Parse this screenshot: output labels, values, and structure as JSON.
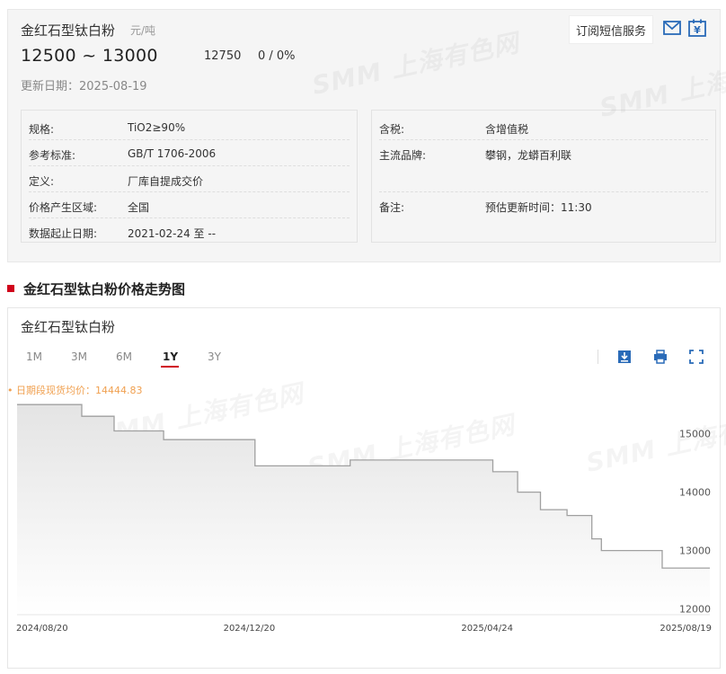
{
  "header": {
    "product_name": "金红石型钛白粉",
    "unit": "元/吨",
    "price_range": "12500 ~ 13000",
    "avg_price": "12750",
    "change": "0 / 0%",
    "update_date": "更新日期：2025-08-19",
    "subscribe_label": "订阅短信服务",
    "mail_icon": "mail-icon",
    "calendar_icon": "yuan-calendar-icon"
  },
  "specs_left": [
    {
      "label": "规格:",
      "value": "TiO2≥90%"
    },
    {
      "label": "参考标准:",
      "value": "GB/T 1706-2006"
    },
    {
      "label": "定义:",
      "value": "厂库自提成交价"
    },
    {
      "label": "价格产生区域:",
      "value": "全国"
    },
    {
      "label": "数据起止日期:",
      "value": "2021-02-24 至 --"
    }
  ],
  "specs_right": [
    {
      "label": "含税:",
      "value": "含增值税"
    },
    {
      "label": "主流品牌:",
      "value": "攀钢，龙蟒百利联"
    },
    {
      "label": "备注:",
      "value": "预估更新时间：11:30"
    }
  ],
  "section_title": "金红石型钛白粉价格走势图",
  "chart_card": {
    "title": "金红石型钛白粉",
    "range_tabs": [
      "1M",
      "3M",
      "6M",
      "1Y",
      "3Y"
    ],
    "active_tab": "1Y",
    "tools": [
      "download-icon",
      "print-icon",
      "fullscreen-icon"
    ],
    "avg_note": "• 日期段现货均价：14444.83"
  },
  "watermark_text": "SMM 上海有色网",
  "chart_data": {
    "type": "area",
    "title": "",
    "xlabel": "",
    "ylabel": "",
    "x_ticks": [
      "2024/08/20",
      "2024/12/20",
      "2025/04/24",
      "2025/08/19"
    ],
    "y_ticks": [
      12000,
      13000,
      14000,
      15000
    ],
    "ylim": [
      11900,
      15550
    ],
    "grid": false,
    "colors": {
      "line": "#a0a0a0",
      "fill_top": "#e4e4e4",
      "fill_bottom": "#ffffff"
    },
    "series": [
      {
        "x": [
          "2024-08-20",
          "2024-09-23",
          "2024-09-23",
          "2024-10-10",
          "2024-10-10",
          "2024-11-05",
          "2024-11-05",
          "2024-12-23",
          "2024-12-23",
          "2025-02-11",
          "2025-02-11",
          "2025-04-27",
          "2025-04-27",
          "2025-05-10",
          "2025-05-10",
          "2025-05-22",
          "2025-05-22",
          "2025-06-05",
          "2025-06-05",
          "2025-06-18",
          "2025-06-18",
          "2025-06-23",
          "2025-06-23",
          "2025-07-25",
          "2025-07-25",
          "2025-08-19"
        ],
        "y": [
          15500,
          15500,
          15300,
          15300,
          15050,
          15050,
          14900,
          14900,
          14450,
          14450,
          14550,
          14550,
          14350,
          14350,
          14000,
          14000,
          13700,
          13700,
          13600,
          13600,
          13200,
          13200,
          13000,
          13000,
          12700,
          12700
        ]
      }
    ]
  }
}
